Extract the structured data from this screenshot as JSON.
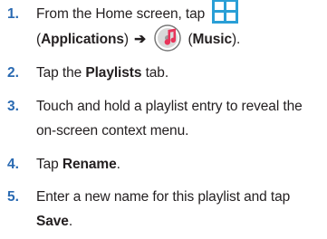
{
  "steps": [
    {
      "number": "1.",
      "text_a": "From the Home screen, tap",
      "paren_open_1": "(",
      "bold_1": "Applications",
      "paren_close_1": ")",
      "arrow": "➔",
      "paren_open_2": "(",
      "bold_2": "Music",
      "paren_close_2": ").",
      "icons": [
        "applications-icon",
        "music-icon"
      ],
      "accent_color": "#2a9fd6"
    },
    {
      "number": "2.",
      "pre": "Tap the ",
      "bold": "Playlists",
      "post": " tab."
    },
    {
      "number": "3.",
      "line1": "Touch and hold a playlist entry to reveal the",
      "line2": "on-screen context menu."
    },
    {
      "number": "4.",
      "pre": "Tap ",
      "bold": "Rename",
      "post": "."
    },
    {
      "number": "5.",
      "line1": "Enter a new name for this playlist and tap",
      "bold": "Save",
      "post": "."
    }
  ],
  "number_color": "#2a6ab2"
}
